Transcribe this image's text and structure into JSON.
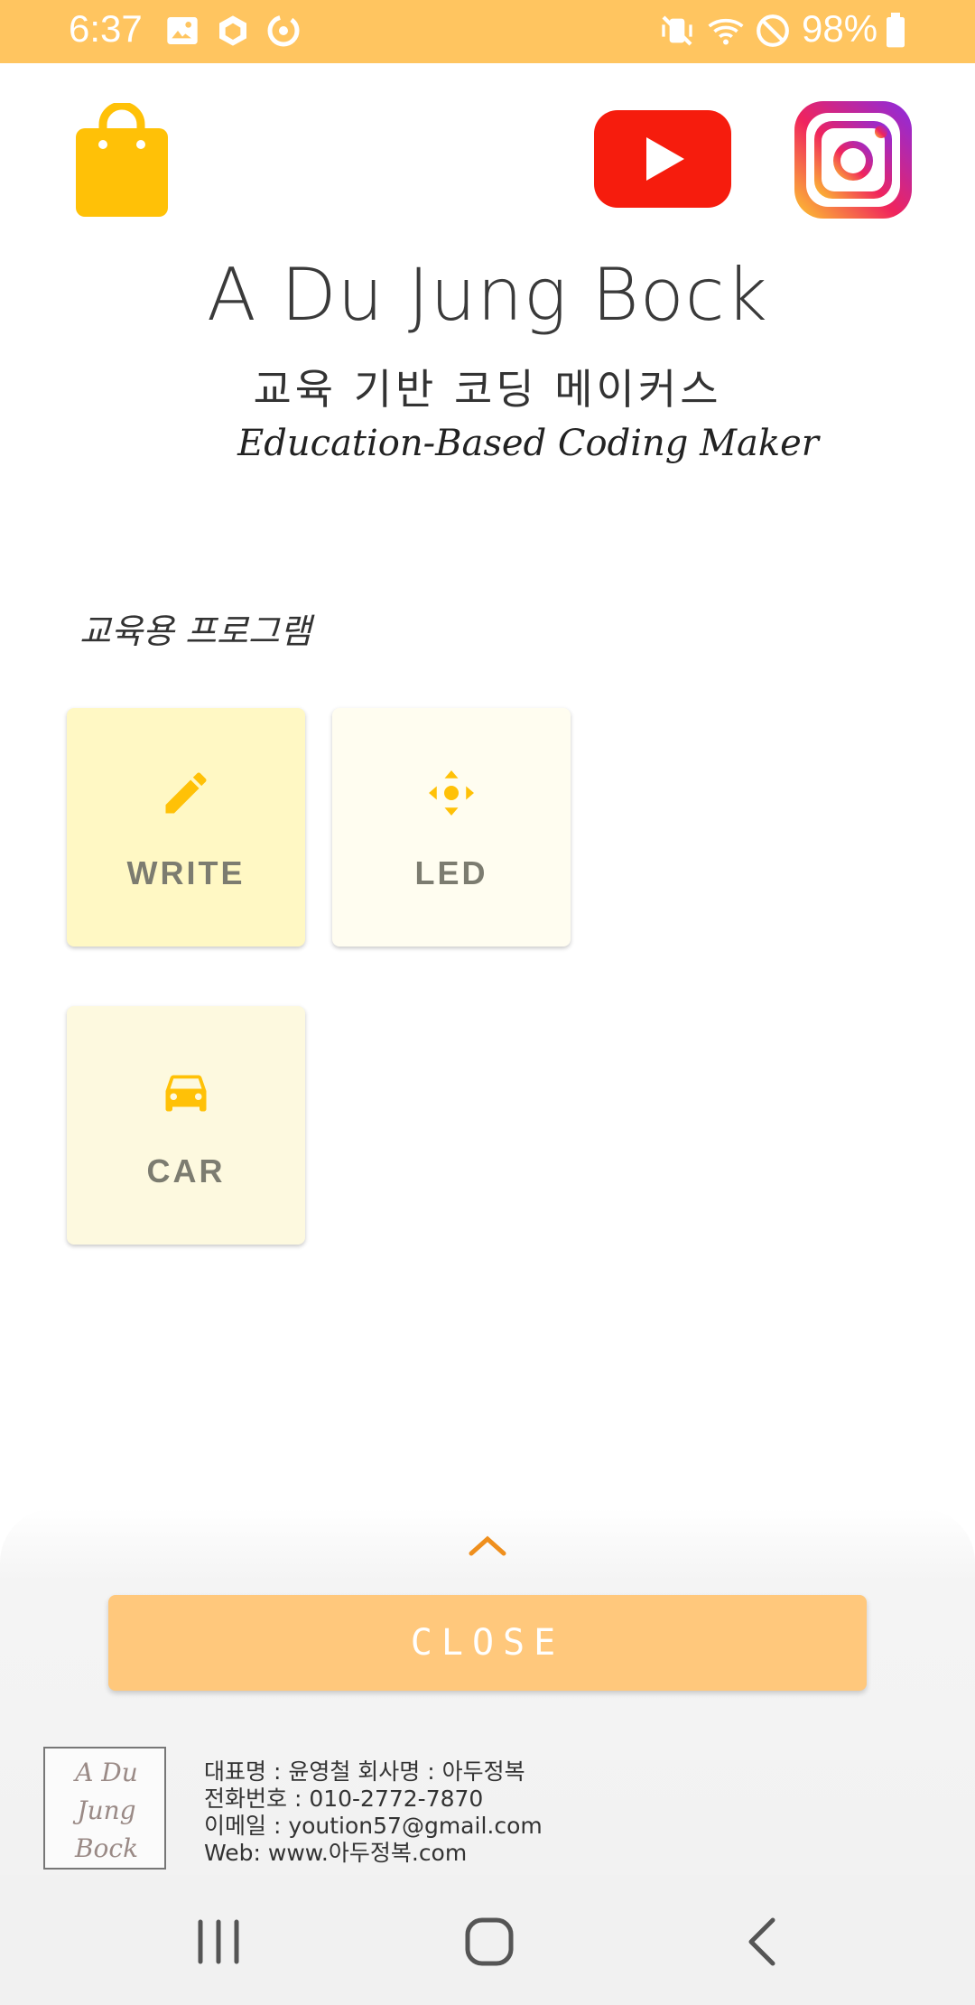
{
  "status_bar": {
    "time": "6:37",
    "battery": "98%",
    "icons": [
      "image-icon",
      "box-icon",
      "sync-icon",
      "vibrate-mute-icon",
      "wifi-icon",
      "do-not-disturb-icon",
      "battery-icon"
    ]
  },
  "header": {
    "icons": [
      "shopping-bag-icon",
      "youtube-icon",
      "instagram-icon"
    ],
    "title": "A Du Jung Bock",
    "subtitle_ko": "교육 기반 코딩 메이커스",
    "subtitle_en": "Education-Based Coding Maker"
  },
  "section": {
    "label": "교육용 프로그램"
  },
  "cards": [
    {
      "label": "WRITE",
      "icon": "pencil-icon",
      "bg": "#fff8c4"
    },
    {
      "label": "LED",
      "icon": "move-arrows-icon",
      "bg": "#fffdf0"
    },
    {
      "label": "CAR",
      "icon": "car-icon",
      "bg": "#fdf9df"
    }
  ],
  "bottom_sheet": {
    "close_label": "CLOSE",
    "logo_text": [
      "A Du",
      "Jung",
      "Bock"
    ],
    "info": [
      "대표명 : 윤영철   회사명 : 아두정복",
      "전화번호 : 010-2772-7870",
      "이메일 : yoution57@gmail.com",
      "Web: www.아두정복.com"
    ]
  },
  "colors": {
    "status_bar": "#ffc560",
    "accent": "#ffc107",
    "close_button": "#ffc87c",
    "chevron": "#ef8f1d"
  }
}
